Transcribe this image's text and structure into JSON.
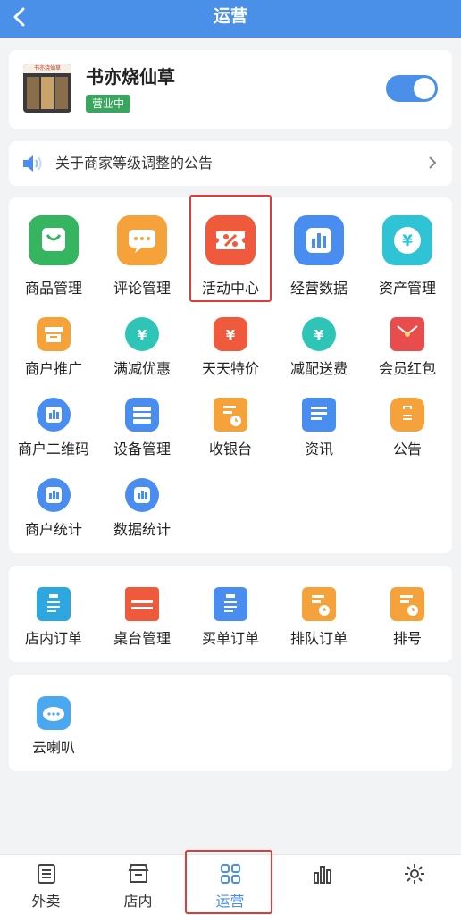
{
  "header": {
    "title": "运营",
    "back_icon": "chevron-left-icon"
  },
  "shop": {
    "name": "书亦烧仙草",
    "status": "营业中",
    "logo_sign": "书亦烧仙草",
    "toggle_on": true
  },
  "notice": {
    "text": "关于商家等级调整的公告",
    "icon": "speaker-icon"
  },
  "section_main": {
    "big_items": [
      {
        "label": "商品管理",
        "icon": "bag-icon",
        "color": "#35b55f"
      },
      {
        "label": "评论管理",
        "icon": "chat-icon",
        "color": "#f5a23a"
      },
      {
        "label": "活动中心",
        "icon": "coupon-percent-icon",
        "color": "#ef5a3c",
        "highlighted": true
      },
      {
        "label": "经营数据",
        "icon": "bar-chart-icon",
        "color": "#4a8df0"
      },
      {
        "label": "资产管理",
        "icon": "yen-coin-icon",
        "color": "#2ec4d6"
      }
    ],
    "small_items": [
      {
        "label": "商户推广",
        "icon": "shop-promo-icon",
        "color": "#f5a23a"
      },
      {
        "label": "满减优惠",
        "icon": "yen-discount-icon",
        "color": "#2ec4b6"
      },
      {
        "label": "天天特价",
        "icon": "yen-ticket-icon",
        "color": "#ef5a3c"
      },
      {
        "label": "减配送费",
        "icon": "yen-delivery-icon",
        "color": "#2ec4b6"
      },
      {
        "label": "会员红包",
        "icon": "red-envelope-icon",
        "color": "#e84c4c"
      },
      {
        "label": "商户二维码",
        "icon": "bar-chart-icon",
        "color": "#4a8df0"
      },
      {
        "label": "设备管理",
        "icon": "device-list-icon",
        "color": "#4a8df0"
      },
      {
        "label": "收银台",
        "icon": "cashier-icon",
        "color": "#f5a23a"
      },
      {
        "label": "资讯",
        "icon": "news-icon",
        "color": "#4a8df0"
      },
      {
        "label": "公告",
        "icon": "notice-bag-icon",
        "color": "#f5a23a"
      },
      {
        "label": "商户统计",
        "icon": "bar-chart-icon",
        "color": "#4a8df0"
      },
      {
        "label": "数据统计",
        "icon": "bar-chart-icon",
        "color": "#4a8df0"
      }
    ]
  },
  "section_orders": {
    "items": [
      {
        "label": "店内订单",
        "icon": "clipboard-icon",
        "color": "#2ea6e0"
      },
      {
        "label": "桌台管理",
        "icon": "table-icon",
        "color": "#ef5a3c"
      },
      {
        "label": "买单订单",
        "icon": "clipboard-icon",
        "color": "#4a8df0"
      },
      {
        "label": "排队订单",
        "icon": "queue-clock-icon",
        "color": "#f5a23a"
      },
      {
        "label": "排号",
        "icon": "queue-clock-icon",
        "color": "#f5a23a"
      }
    ]
  },
  "section_speaker": {
    "items": [
      {
        "label": "云喇叭",
        "icon": "cloud-speaker-icon",
        "color": "#4aa8f0"
      }
    ]
  },
  "tabbar": {
    "tabs": [
      {
        "label": "外卖",
        "icon": "list-doc-icon"
      },
      {
        "label": "店内",
        "icon": "store-icon"
      },
      {
        "label": "运营",
        "icon": "grid-icon",
        "active": true
      },
      {
        "label": "",
        "icon": "bar-chart-icon"
      },
      {
        "label": "",
        "icon": "gear-icon"
      }
    ]
  },
  "colors": {
    "primary": "#4a90e8",
    "highlight_border": "#e03a3a",
    "open_badge": "#3aa55f"
  }
}
